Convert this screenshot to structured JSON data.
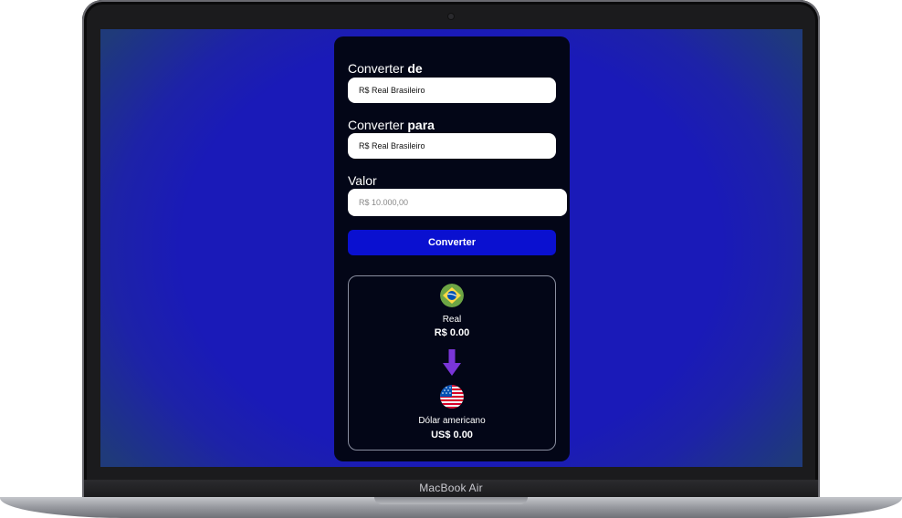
{
  "device": {
    "brand": "MacBook Air"
  },
  "form": {
    "from_label_prefix": "Converter",
    "from_label_bold": "de",
    "from_value": "R$ Real Brasileiro",
    "to_label_prefix": "Converter",
    "to_label_bold": "para",
    "to_value": "R$ Real Brasileiro",
    "amount_label": "Valor",
    "amount_placeholder": "R$ 10.000,00",
    "convert_button": "Converter"
  },
  "result": {
    "source": {
      "name": "Real",
      "value": "R$ 0.00",
      "flag": "brazil-flag-icon"
    },
    "arrow": "arrow-down-icon",
    "target": {
      "name": "Dólar americano",
      "value": "US$ 0.00",
      "flag": "usa-flag-icon"
    }
  },
  "colors": {
    "screen_bg": "#1a1ab8",
    "card_bg": "#030617",
    "button_bg": "#0a10d0",
    "arrow": "#7a35d8"
  }
}
